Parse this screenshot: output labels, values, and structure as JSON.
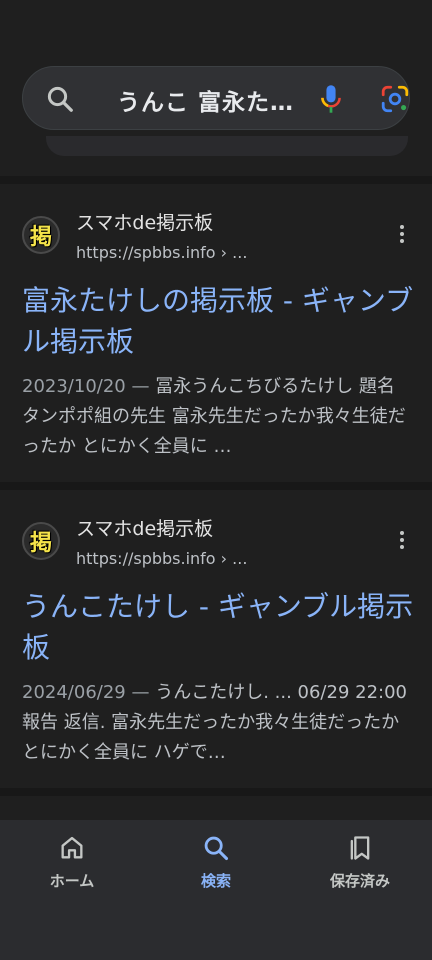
{
  "search": {
    "query": "うんこ 富永た…"
  },
  "results": [
    {
      "site_name": "スマホde掲示板",
      "url": "https://spbbs.info › ...",
      "favicon_char": "掲",
      "title": "富永たけしの掲示板 - ギャンブル掲示板",
      "date": "2023/10/20",
      "dash": " — ",
      "snippet": "冨永うんこちびるたけし 題名 タンポポ組の先生 富永先生だったか我々生徒だったか とにかく全員に …"
    },
    {
      "site_name": "スマホde掲示板",
      "url": "https://spbbs.info › ...",
      "favicon_char": "掲",
      "title": "うんこたけし - ギャンブル掲示板",
      "date": "2024/06/29",
      "dash": " — ",
      "snippet": "うんこたけし. ... 06/29 22:00 報告 返信. 富永先生だったか我々生徒だったか とにかく全員に ハゲで…"
    }
  ],
  "bottom_nav": {
    "home": "ホーム",
    "search": "検索",
    "saved": "保存済み"
  },
  "colors": {
    "background": "#1f1f1f",
    "link_blue": "#8ab4f8",
    "nav_background": "#2b2c2f"
  }
}
